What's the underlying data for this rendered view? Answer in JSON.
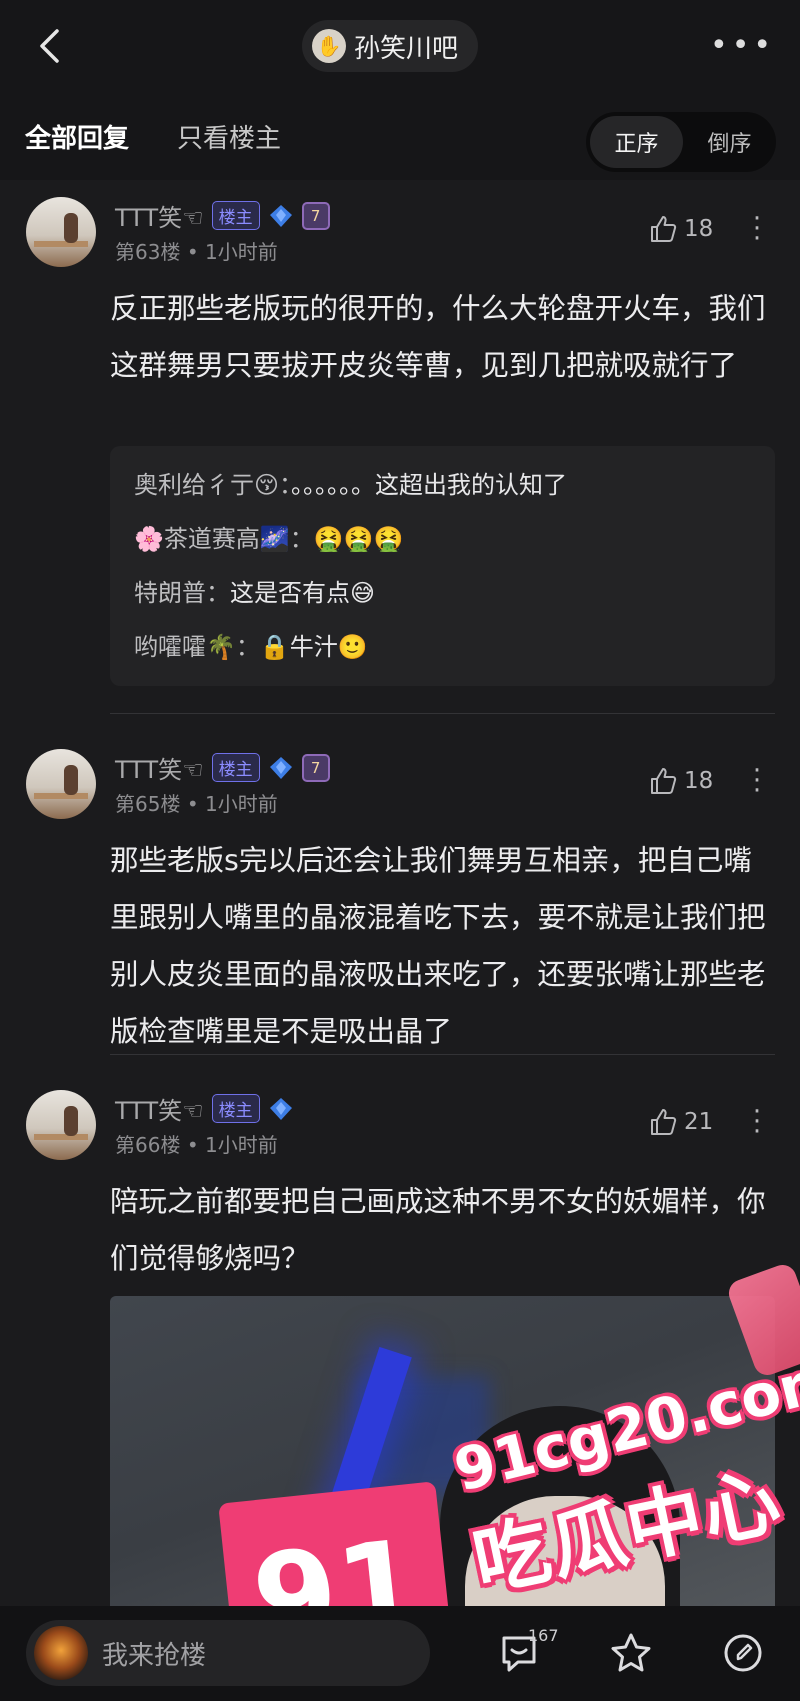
{
  "header": {
    "forum_icon": "hand-icon",
    "forum_name": "孙笑川吧",
    "more": "•••"
  },
  "tabs": {
    "all": "全部回复",
    "owner_only": "只看楼主"
  },
  "order": {
    "asc": "正序",
    "desc": "倒序",
    "selected": "正序"
  },
  "colors": {
    "background": "#1b1b1d",
    "owner_badge": "#6f70e8",
    "watermark": "#ef3d74"
  },
  "posts": [
    {
      "username": "TTT笑☜",
      "badge": "楼主",
      "level": "7",
      "floor": "第63楼",
      "time": "1小时前",
      "likes": "18",
      "content": "反正那些老版玩的很开的，什么大轮盘开火车，我们这群舞男只要拔开皮炎等曹，见到几把就吸就行了",
      "replies": [
        {
          "who": "奥利给彳亍😚：",
          "text": "。。。。。。这超出我的认知了"
        },
        {
          "who": "🌸茶道赛高🌌：",
          "text": "🤮🤮🤮"
        },
        {
          "who": "特朗普：",
          "text": "这是否有点😅"
        },
        {
          "who": "哟嚯嚯🌴：",
          "text": "🔒牛汁🙂"
        }
      ]
    },
    {
      "username": "TTT笑☜",
      "badge": "楼主",
      "level": "7",
      "floor": "第65楼",
      "time": "1小时前",
      "likes": "18",
      "content": "那些老版s完以后还会让我们舞男互相亲，把自己嘴里跟别人嘴里的晶液混着吃下去，要不就是让我们把别人皮炎里面的晶液吸出来吃了，还要张嘴让那些老版检查嘴里是不是吸出晶了"
    },
    {
      "username": "TTT笑☜",
      "badge": "楼主",
      "level": "7",
      "floor": "第66楼",
      "time": "1小时前",
      "likes": "21",
      "content": "陪玩之前都要把自己画成这种不男不女的妖媚样，你们觉得够烧吗？"
    }
  ],
  "bottom": {
    "placeholder": "我来抢楼",
    "comment_count": "167"
  },
  "watermark": {
    "number": "91",
    "url": "91cg20.com",
    "text": "吃瓜中心"
  }
}
